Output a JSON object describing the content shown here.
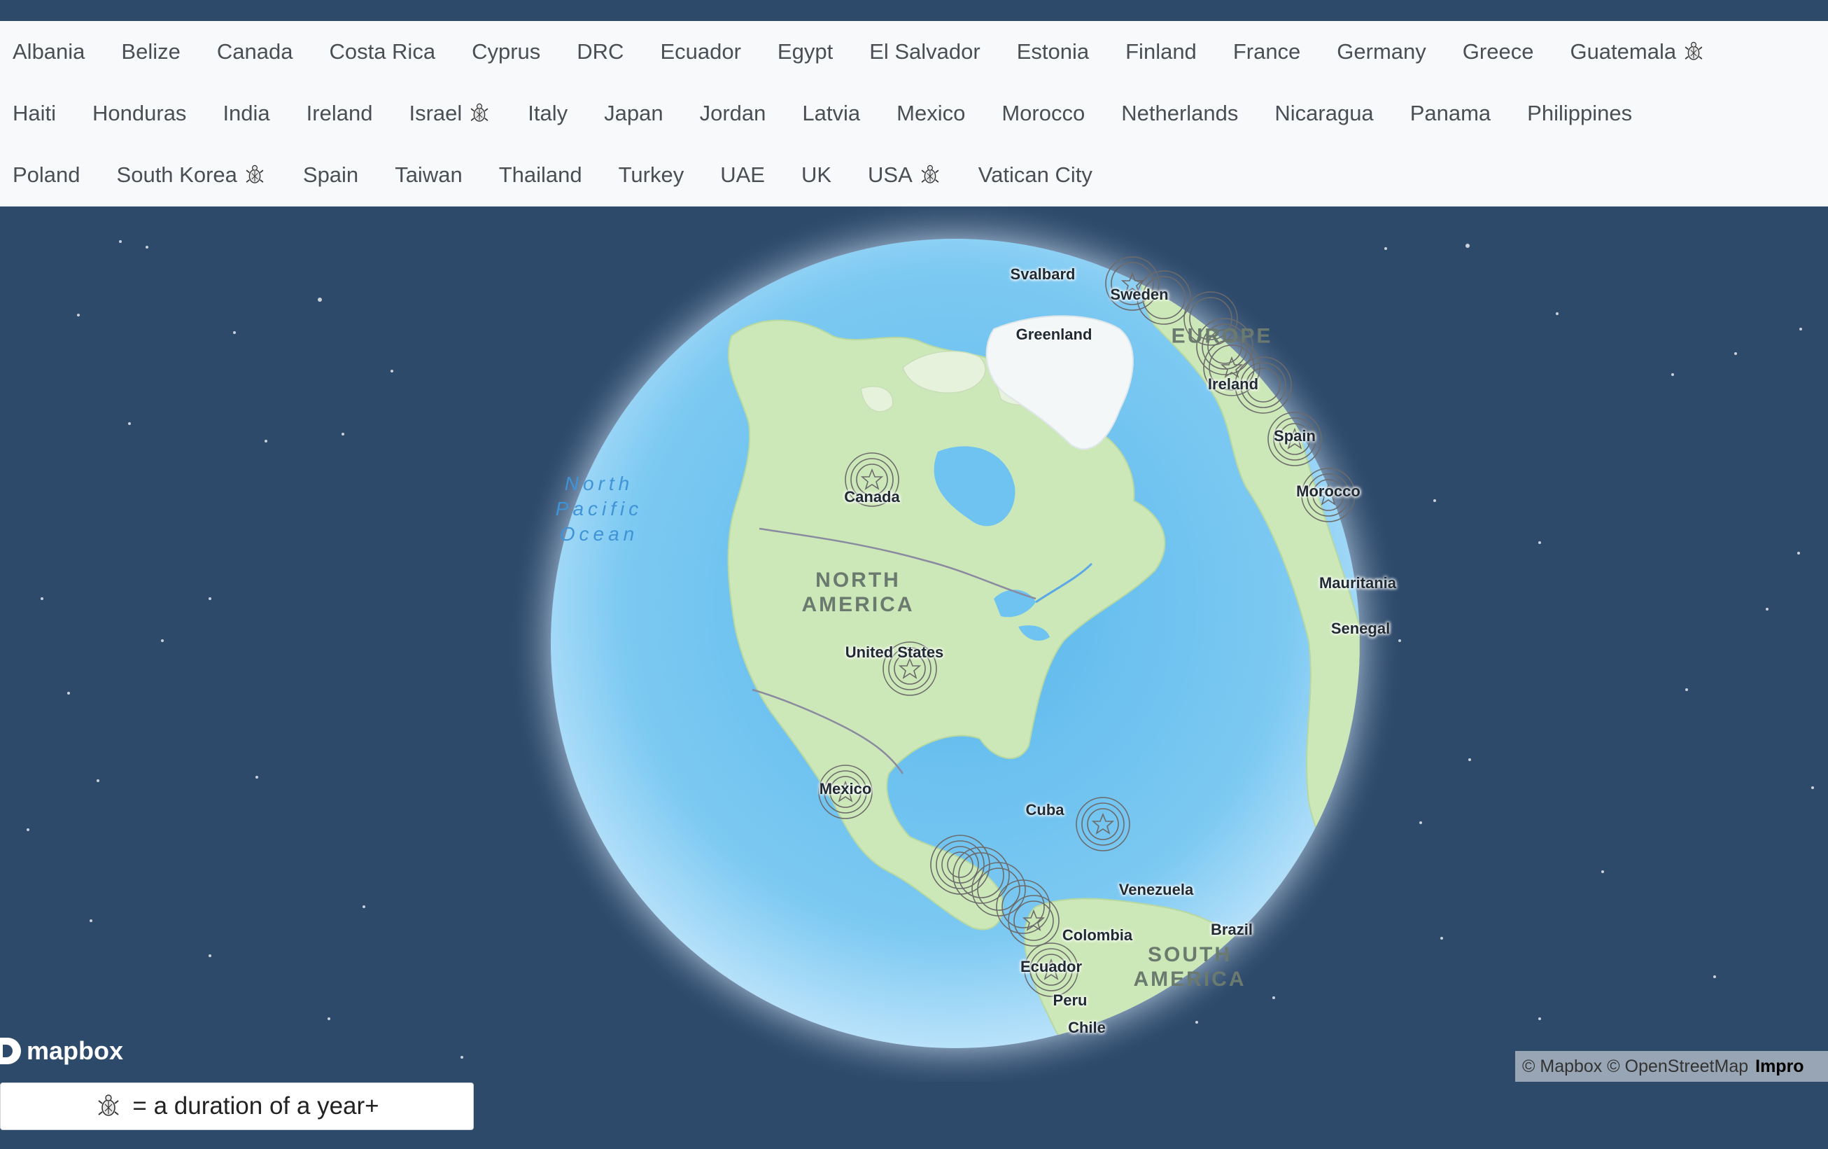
{
  "nav": {
    "rows": [
      [
        "Albania",
        "Belize",
        "Canada",
        "Costa Rica",
        "Cyprus",
        "DRC",
        "Ecuador",
        "Egypt",
        "El Salvador",
        "Estonia",
        "Finland",
        "France",
        "Germany",
        "Greece",
        "Guatemala"
      ],
      [
        "Haiti",
        "Honduras",
        "India",
        "Ireland",
        "Israel",
        "Italy",
        "Japan",
        "Jordan",
        "Latvia",
        "Mexico",
        "Morocco",
        "Netherlands",
        "Nicaragua",
        "Panama",
        "Philippines"
      ],
      [
        "Poland",
        "South Korea",
        "Spain",
        "Taiwan",
        "Thailand",
        "Turkey",
        "UAE",
        "UK",
        "USA",
        "Vatican City"
      ]
    ],
    "year_plus_countries": [
      "Guatemala",
      "Israel",
      "South Korea",
      "USA"
    ]
  },
  "map": {
    "place_labels": [
      "Svalbard",
      "Sweden",
      "Greenland",
      "Ireland",
      "Spain",
      "Morocco",
      "Canada",
      "Mauritania",
      "Senegal",
      "United States",
      "Mexico",
      "Cuba",
      "Venezuela",
      "Brazil",
      "Colombia",
      "Ecuador",
      "Peru",
      "Chile"
    ],
    "region_labels": [
      "EUROPE",
      "NORTH\nAMERICA",
      "SOUTH\nAMERICA"
    ],
    "ocean_labels": [
      "North\nPacific\nOcean"
    ],
    "marker_icon": "star-icon",
    "colors": {
      "space": "#2e4a6b",
      "ocean": "#6fc3f0",
      "land": "#c9e6b4",
      "ice": "#f4f7f8",
      "marker": "#6a6a6a"
    }
  },
  "logo": {
    "text": "mapbox"
  },
  "attribution": {
    "mapbox": "© Mapbox",
    "osm": "© OpenStreetMap",
    "improve": "Impro"
  },
  "legend": {
    "icon": "turtle-icon",
    "text": "= a duration of a year+"
  }
}
